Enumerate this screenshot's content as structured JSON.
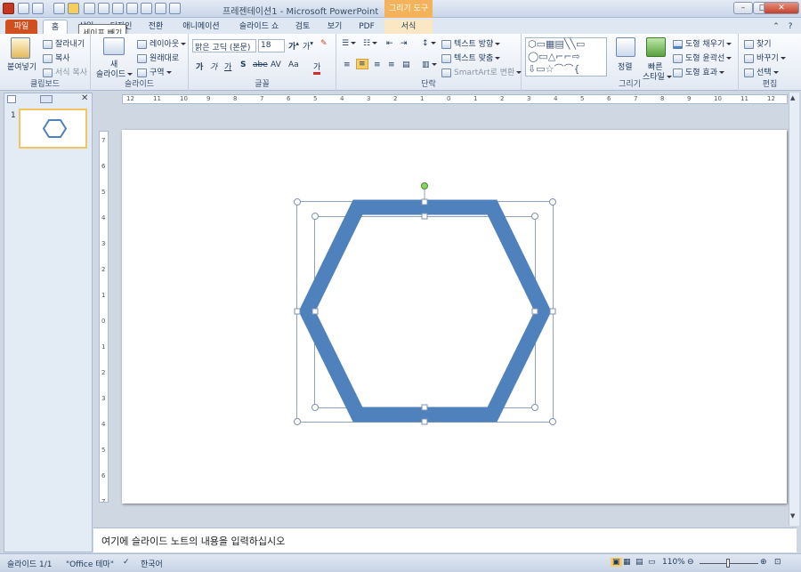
{
  "window": {
    "title": "프레젠테이션1 - Microsoft PowerPoint",
    "context_tab": "그리기 도구"
  },
  "tabs": [
    "파일",
    "홈",
    "삽입",
    "디자인",
    "전환",
    "애니메이션",
    "슬라이드 쇼",
    "검토",
    "보기",
    "PDF",
    "서식"
  ],
  "tooltip": "세이프 빼기",
  "clipboard": {
    "paste": "붙여넣기",
    "cut": "잘라내기",
    "copy": "복사",
    "format_copy": "서식 복사",
    "group": "클립보드"
  },
  "slides": {
    "new": "새",
    "new2": "슬라이드",
    "layout": "레이아웃",
    "reset": "원래대로",
    "section": "구역",
    "group": "슬라이드"
  },
  "font": {
    "name": "맑은 고딕 (본문)",
    "size": "18",
    "group": "글꼴",
    "bold": "가",
    "italic": "가",
    "underline": "가",
    "strike": "S",
    "abc": "abe",
    "spacing": "AV",
    "case": "Aa",
    "color": "가"
  },
  "paragraph": {
    "direction": "텍스트 방향",
    "align": "텍스트 맞춤",
    "smartart": "SmartArt로 변환",
    "group": "단락"
  },
  "drawing": {
    "arrange": "정렬",
    "quick": "빠른",
    "quick2": "스타일",
    "fill": "도형 채우기",
    "outline": "도형 윤곽선",
    "effects": "도형 효과",
    "group": "그리기"
  },
  "editing": {
    "find": "찾기",
    "replace": "바꾸기",
    "select": "선택",
    "group": "편집"
  },
  "notes": {
    "placeholder": "여기에 슬라이드 노트의 내용을 입력하십시오"
  },
  "status": {
    "slide": "슬라이드 1/1",
    "theme": "\"Office 테마\"",
    "lang": "한국어",
    "zoom": "110%"
  },
  "thumbnail": {
    "number": "1"
  },
  "ruler": {
    "h_ticks": [
      "12",
      "11",
      "10",
      "9",
      "8",
      "7",
      "6",
      "5",
      "4",
      "3",
      "2",
      "1",
      "0",
      "1",
      "2",
      "3",
      "4",
      "5",
      "6",
      "7",
      "8",
      "9",
      "10",
      "11",
      "12"
    ],
    "v_ticks": [
      "7",
      "6",
      "5",
      "4",
      "3",
      "2",
      "1",
      "0",
      "1",
      "2",
      "3",
      "4",
      "5",
      "6",
      "7"
    ]
  },
  "colors": {
    "shape_stroke": "#4f81bd",
    "accent": "#cf4f1f",
    "context": "#f4b35a"
  }
}
